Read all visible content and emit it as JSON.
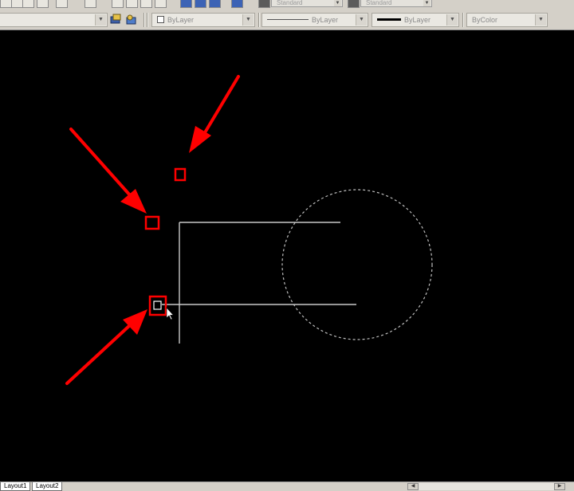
{
  "toolbar": {
    "text_style": "Standard",
    "dim_style": "Standard"
  },
  "properties": {
    "color": "ByLayer",
    "linetype": "ByLayer",
    "lineweight": "ByLayer",
    "plot_style": "ByColor"
  },
  "tabs": [
    "Layout1",
    "Layout2"
  ],
  "colors": {
    "canvas": "#000000",
    "geometry": "#c8c8c8",
    "annotation": "#ff0000",
    "circle": "#bfbfbf"
  },
  "icons": {
    "standard_toolbar": [
      "folder-icon",
      "save-icon",
      "print-icon",
      "pan-icon",
      "zoom-realtime-icon",
      "zoom-window-icon",
      "zoom-previous-icon",
      "properties-icon",
      "design-center-icon",
      "tool-palettes-icon",
      "help-icon"
    ],
    "annotation": [
      "arrow-icon",
      "grip-icon",
      "cursor-icon"
    ]
  }
}
